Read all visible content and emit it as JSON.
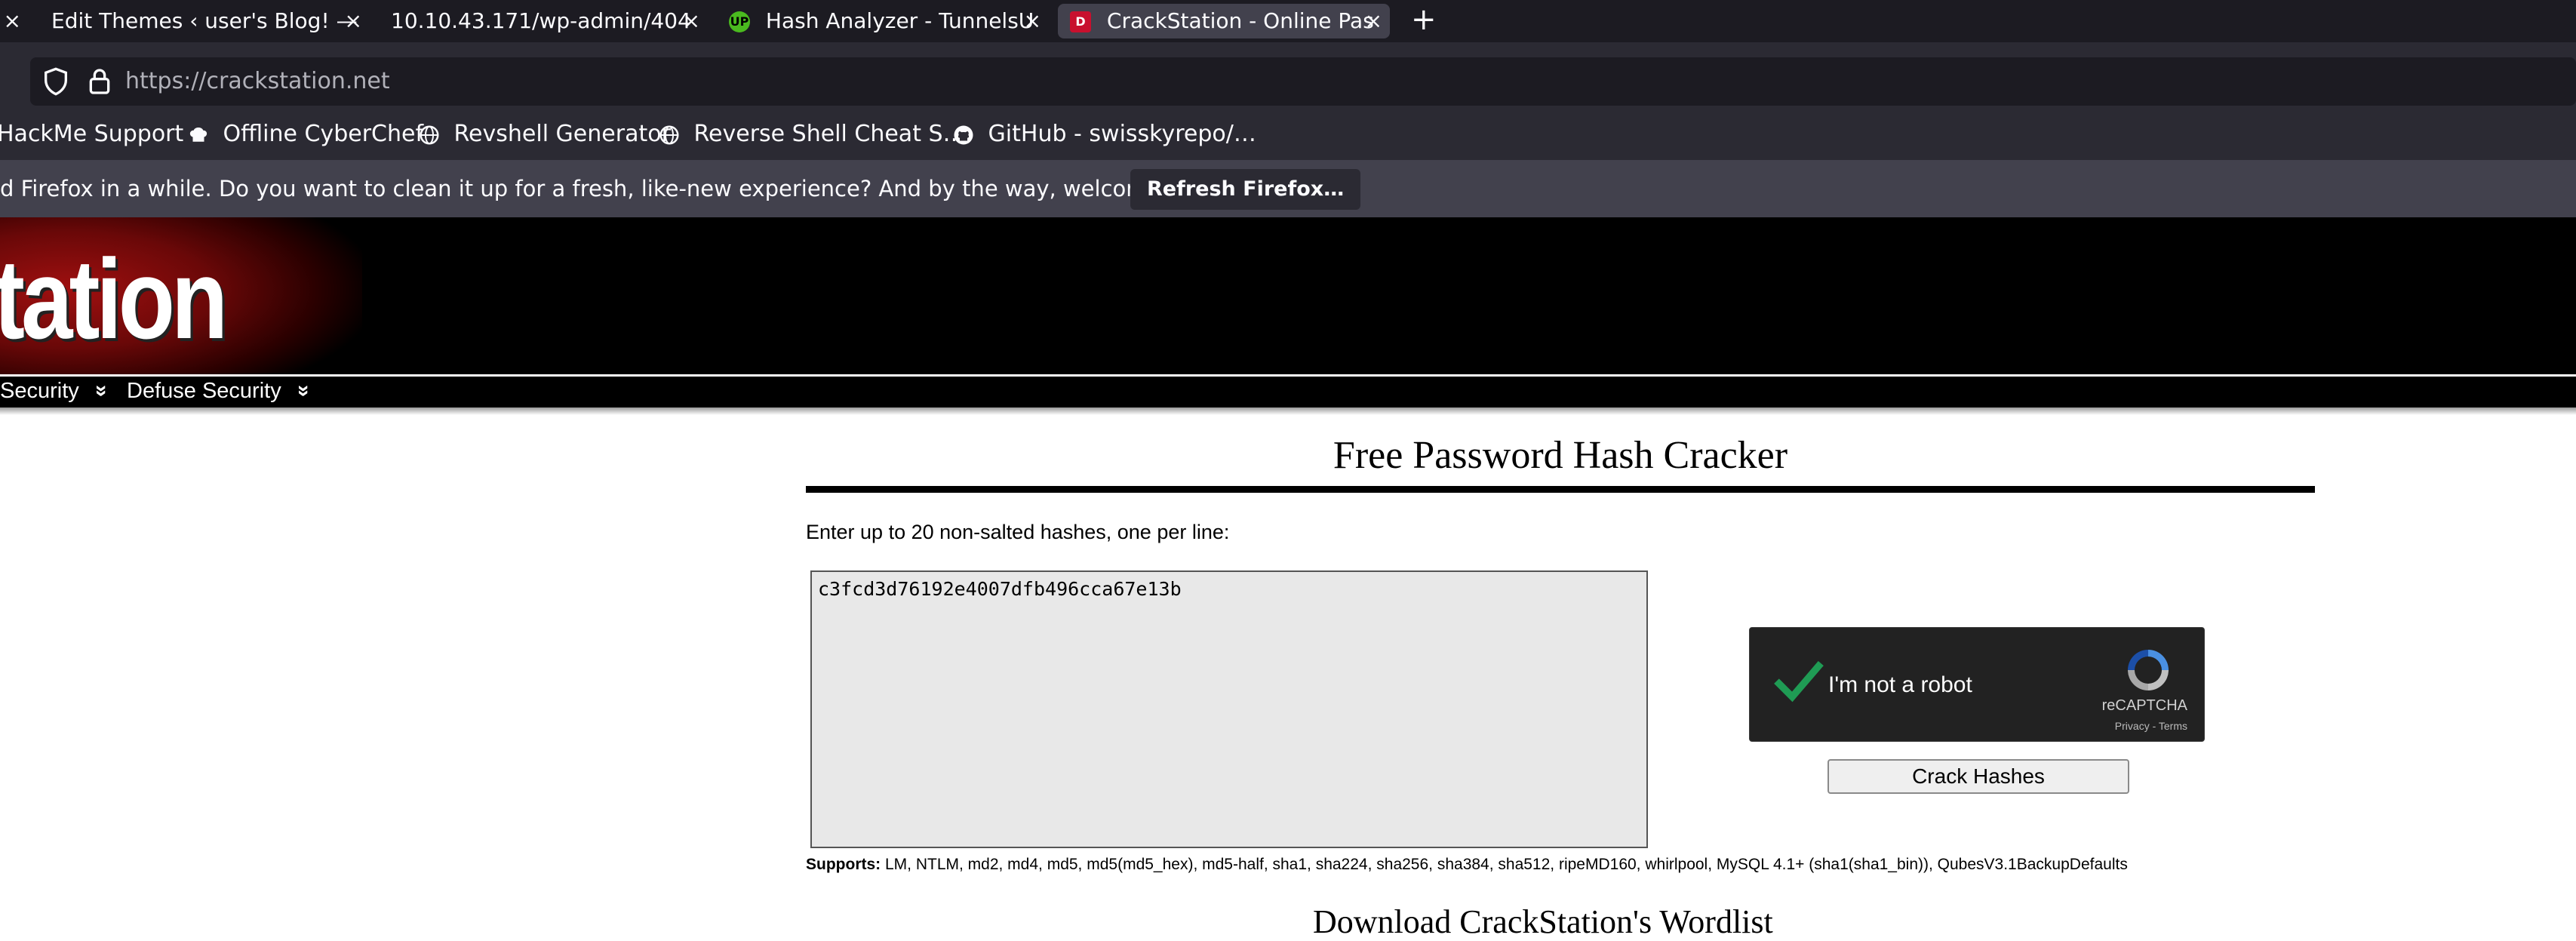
{
  "browser": {
    "tabs": [
      {
        "label": "",
        "close": "×"
      },
      {
        "label": "Edit Themes ‹ user's Blog! —",
        "close": "×"
      },
      {
        "label": "10.10.43.171/wp-admin/404",
        "close": "×"
      },
      {
        "label": "Hash Analyzer - TunnelsU",
        "close": "×",
        "favicon": "UP"
      },
      {
        "label": "CrackStation - Online Pas",
        "close": "×",
        "favicon": "D",
        "active": true
      }
    ],
    "new_tab": "+",
    "url": "https://crackstation.net",
    "bookmarks": [
      "HackMe Support",
      "Offline CyberChef",
      "Revshell Generator",
      "Reverse Shell Cheat S…",
      "GitHub - swisskyrepo/…"
    ],
    "notification": {
      "message": "d Firefox in a while. Do you want to clean it up for a fresh, like-new experience? And by the way, welcome back!",
      "button": "Refresh Firefox…"
    }
  },
  "site": {
    "logo_text": "tation",
    "menu": [
      {
        "label": "Security",
        "chevron": "»"
      },
      {
        "label": "Defuse Security",
        "chevron": "»"
      }
    ]
  },
  "main": {
    "title": "Free Password Hash Cracker",
    "instruction": "Enter up to 20 non-salted hashes, one per line:",
    "hash_value": "c3fcd3d76192e4007dfb496cca67e13b",
    "recaptcha": {
      "label": "I'm not a robot",
      "brand": "reCAPTCHA",
      "links": "Privacy - Terms"
    },
    "crack_button": "Crack Hashes",
    "supports_label": "Supports:",
    "supports_text": " LM, NTLM, md2, md4, md5, md5(md5_hex), md5-half, sha1, sha224, sha256, sha384, sha512, ripeMD160, whirlpool, MySQL 4.1+ (sha1(sha1_bin)), QubesV3.1BackupDefaults",
    "next_heading": "Download CrackStation's Wordlist"
  },
  "colors": {
    "tabstrip": "#1c1b22",
    "toolbar": "#2b2a33",
    "active_tab": "#42414d",
    "banner": "#000000",
    "check_green": "#1f9b54"
  }
}
